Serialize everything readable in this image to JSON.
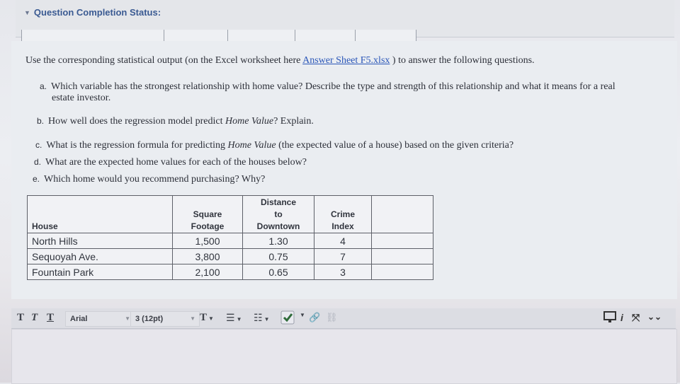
{
  "status": {
    "title": "Question Completion Status:"
  },
  "intro": {
    "text_before": "Use the corresponding statistical output (on the Excel worksheet here ",
    "link": "Answer Sheet F5.xlsx",
    "text_after": " ) to answer the following questions."
  },
  "questions": [
    {
      "label": "a.",
      "text": "Which variable has the strongest relationship with home value? Describe the type and strength of this relationship and what it means for a real",
      "text2": "estate investor."
    },
    {
      "label": "b.",
      "text_before": "How well does the regression model predict ",
      "italic": "Home Value",
      "text_after": "? Explain."
    },
    {
      "label": "c.",
      "text_before": "What is the regression formula for predicting ",
      "italic": "Home Value",
      "text_after": " (the expected value of a house) based on the given criteria?"
    },
    {
      "label": "d.",
      "text": "What are the expected home values for each of the houses below?"
    },
    {
      "label": "e.",
      "text": "Which home would you recommend purchasing? Why?"
    }
  ],
  "table": {
    "headers": {
      "house": "House",
      "sqft_1": "Square",
      "sqft_2": "Footage",
      "dist_1": "Distance",
      "dist_2": "to",
      "dist_3": "Downtown",
      "crime_1": "Crime",
      "crime_2": "Index"
    },
    "rows": [
      {
        "house": "North Hills",
        "sqft": "1,500",
        "distance": "1.30",
        "crime": "4"
      },
      {
        "house": "Sequoyah Ave.",
        "sqft": "3,800",
        "distance": "0.75",
        "crime": "7"
      },
      {
        "house": "Fountain Park",
        "sqft": "2,100",
        "distance": "0.65",
        "crime": "3"
      }
    ]
  },
  "toolbar": {
    "bold": "T",
    "italic": "T",
    "underline": "T",
    "font": "Arial",
    "size": "3 (12pt)",
    "text_color": "T"
  },
  "colors": {
    "title": "#3a5a92",
    "link": "#2a56b8"
  }
}
